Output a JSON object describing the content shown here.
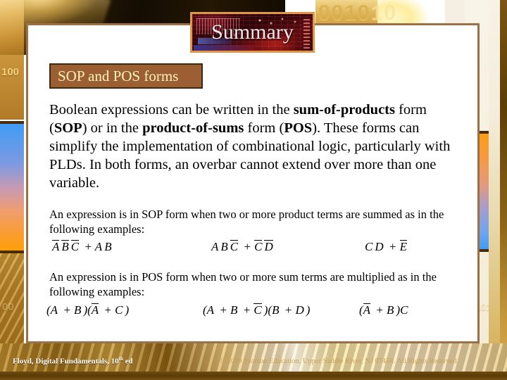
{
  "slide": {
    "title": "Summary",
    "section_label": "SOP and POS forms",
    "main_paragraph_parts": [
      {
        "text": "Boolean expressions can be written in the ",
        "bold": false
      },
      {
        "text": "sum-of-products",
        "bold": true
      },
      {
        "text": " form (",
        "bold": false
      },
      {
        "text": "SOP",
        "bold": true
      },
      {
        "text": ") or in the ",
        "bold": false
      },
      {
        "text": "product-of-sums",
        "bold": true
      },
      {
        "text": " form (",
        "bold": false
      },
      {
        "text": "POS",
        "bold": true
      },
      {
        "text": "). These forms can simplify the implementation of combinational logic, particularly with PLDs. In both forms, an overbar cannot extend over more than one variable.",
        "bold": false
      }
    ],
    "sop": {
      "intro": "An expression is in SOP form when two or more product terms are summed as in the following examples:",
      "examples": [
        {
          "id": "sop-example-1",
          "terms": [
            {
              "v": "A",
              "bar": true
            },
            {
              "v": "B",
              "bar": true
            },
            {
              "v": "C",
              "bar": true
            },
            {
              "op": "+"
            },
            {
              "v": "A",
              "bar": false
            },
            {
              "v": "B",
              "bar": false
            }
          ]
        },
        {
          "id": "sop-example-2",
          "terms": [
            {
              "v": "A",
              "bar": false
            },
            {
              "v": "B",
              "bar": false
            },
            {
              "v": "C",
              "bar": true
            },
            {
              "op": "+"
            },
            {
              "v": "C",
              "bar": true
            },
            {
              "v": "D",
              "bar": true
            }
          ]
        },
        {
          "id": "sop-example-3",
          "terms": [
            {
              "v": "C",
              "bar": false
            },
            {
              "v": "D",
              "bar": false
            },
            {
              "op": "+"
            },
            {
              "v": "E",
              "bar": true
            }
          ]
        }
      ],
      "examples_plain": [
        "A B C + A B",
        "A B C + C D",
        "C D + E"
      ]
    },
    "pos": {
      "intro": "An expression is in POS form when two or more sum terms are multiplied as in the following examples:",
      "examples": [
        {
          "id": "pos-example-1",
          "terms": [
            {
              "op": "("
            },
            {
              "v": "A",
              "bar": false
            },
            {
              "op": "+"
            },
            {
              "v": "B",
              "bar": false
            },
            {
              "op": ")("
            },
            {
              "v": "A",
              "bar": true
            },
            {
              "op": "+"
            },
            {
              "v": "C",
              "bar": false
            },
            {
              "op": ")"
            }
          ]
        },
        {
          "id": "pos-example-2",
          "terms": [
            {
              "op": "("
            },
            {
              "v": "A",
              "bar": false
            },
            {
              "op": "+"
            },
            {
              "v": "B",
              "bar": false
            },
            {
              "op": "+"
            },
            {
              "v": "C",
              "bar": true
            },
            {
              "op": ")("
            },
            {
              "v": "B",
              "bar": false
            },
            {
              "op": "+"
            },
            {
              "v": "D",
              "bar": false
            },
            {
              "op": ")"
            }
          ]
        },
        {
          "id": "pos-example-3",
          "terms": [
            {
              "op": "("
            },
            {
              "v": "A",
              "bar": true
            },
            {
              "op": "+"
            },
            {
              "v": "B",
              "bar": false
            },
            {
              "op": ")"
            },
            {
              "v": "C",
              "bar": false
            }
          ]
        }
      ],
      "examples_plain": [
        "(A + B)(A + C)",
        "(A + B + C)(B + D)",
        "(A + B)C"
      ]
    }
  },
  "footer": {
    "left_text": "Floyd, Digital Fundamentals, 10",
    "left_superscript": "th",
    "left_suffix": " ed",
    "copyright": "© 2009 Pearson Education, Upper Saddle River, NJ 07458. All Rights Reserved"
  },
  "background": {
    "digits_top": "0010",
    "digits_top_faded": "10",
    "digits_left": "100",
    "digits_left_lower": "00",
    "digits_right_lower": "1101"
  },
  "colors": {
    "panel_border": "#9c7046",
    "label_box_bg": "#9c5f33",
    "label_box_text": "#fdf3b8",
    "title_banner_border": "#e0974a",
    "title_text": "#f4e8ee",
    "accent_blue": "#3f9bf5",
    "accent_orange": "#fb9d14",
    "footer_copyright_text": "#c9a157",
    "footer_left_text": "#ffffff"
  }
}
